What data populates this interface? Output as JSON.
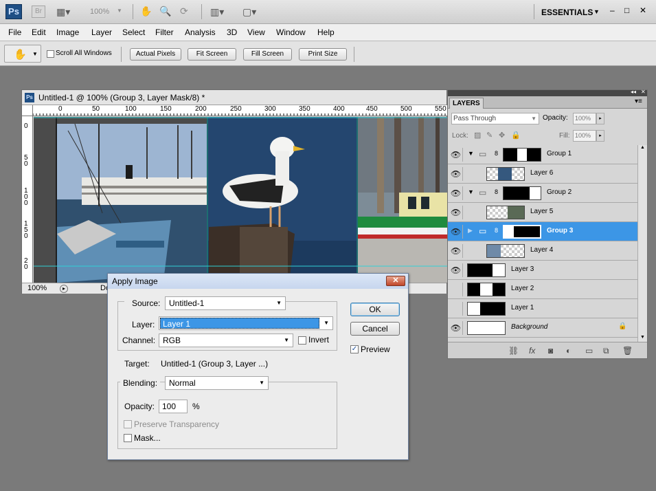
{
  "app": {
    "logo": "Ps",
    "bridge": "Br",
    "zoom": "100%",
    "workspace": "ESSENTIALS"
  },
  "window_controls": {
    "minimize": "–",
    "restore": "□",
    "close": "✕"
  },
  "menu": [
    "File",
    "Edit",
    "Image",
    "Layer",
    "Select",
    "Filter",
    "Analysis",
    "3D",
    "View",
    "Window",
    "Help"
  ],
  "options": {
    "scroll_all": "Scroll All Windows",
    "actual_pixels": "Actual Pixels",
    "fit_screen": "Fit Screen",
    "fill_screen": "Fill Screen",
    "print_size": "Print Size"
  },
  "document": {
    "title": "Untitled-1 @ 100% (Group 3, Layer Mask/8) *",
    "zoom": "100%",
    "status": "Do",
    "ruler_h": [
      "0",
      "50",
      "100",
      "150",
      "200",
      "250",
      "300",
      "350",
      "400",
      "450",
      "500",
      "550"
    ],
    "ruler_v": [
      "0",
      "5\n0",
      "1\n0\n0",
      "1\n5\n0",
      "2\n0"
    ]
  },
  "dialog": {
    "title": "Apply Image",
    "source_label": "Source:",
    "source_value": "Untitled-1",
    "layer_label": "Layer:",
    "layer_value": "Layer 1",
    "channel_label": "Channel:",
    "channel_value": "RGB",
    "invert_label": "Invert",
    "target_label": "Target:",
    "target_value": "Untitled-1 (Group 3, Layer ...)",
    "blending_label": "Blending:",
    "blending_value": "Normal",
    "opacity_label": "Opacity:",
    "opacity_value": "100",
    "opacity_unit": "%",
    "preserve_label": "Preserve Transparency",
    "mask_label": "Mask...",
    "ok_label": "OK",
    "cancel_label": "Cancel",
    "preview_label": "Preview",
    "preview_checked": true,
    "invert_checked": false,
    "mask_checked": false
  },
  "layers_panel": {
    "tab": "LAYERS",
    "blend_mode": "Pass Through",
    "opacity_label": "Opacity:",
    "opacity_value": "100%",
    "lock_label": "Lock:",
    "fill_label": "Fill:",
    "fill_value": "100%",
    "layers": [
      {
        "name": "Group 1",
        "kind": "group",
        "visible": true,
        "selected": false
      },
      {
        "name": "Layer 6",
        "kind": "layer",
        "visible": true,
        "selected": false,
        "indent": true
      },
      {
        "name": "Group 2",
        "kind": "group",
        "visible": true,
        "selected": false
      },
      {
        "name": "Layer 5",
        "kind": "layer",
        "visible": true,
        "selected": false,
        "indent": true
      },
      {
        "name": "Group 3",
        "kind": "group",
        "visible": true,
        "selected": true
      },
      {
        "name": "Layer 4",
        "kind": "layer",
        "visible": true,
        "selected": false,
        "indent": true
      },
      {
        "name": "Layer 3",
        "kind": "layer",
        "visible": true,
        "selected": false
      },
      {
        "name": "Layer 2",
        "kind": "layer",
        "visible": false,
        "selected": false
      },
      {
        "name": "Layer 1",
        "kind": "layer",
        "visible": false,
        "selected": false
      },
      {
        "name": "Background",
        "kind": "background",
        "visible": true,
        "selected": false
      }
    ]
  },
  "colors": {
    "selection": "#3c96e6",
    "dialog_title": "#c7d6ee",
    "sky": "#8da7c6",
    "water": "#24466f"
  }
}
